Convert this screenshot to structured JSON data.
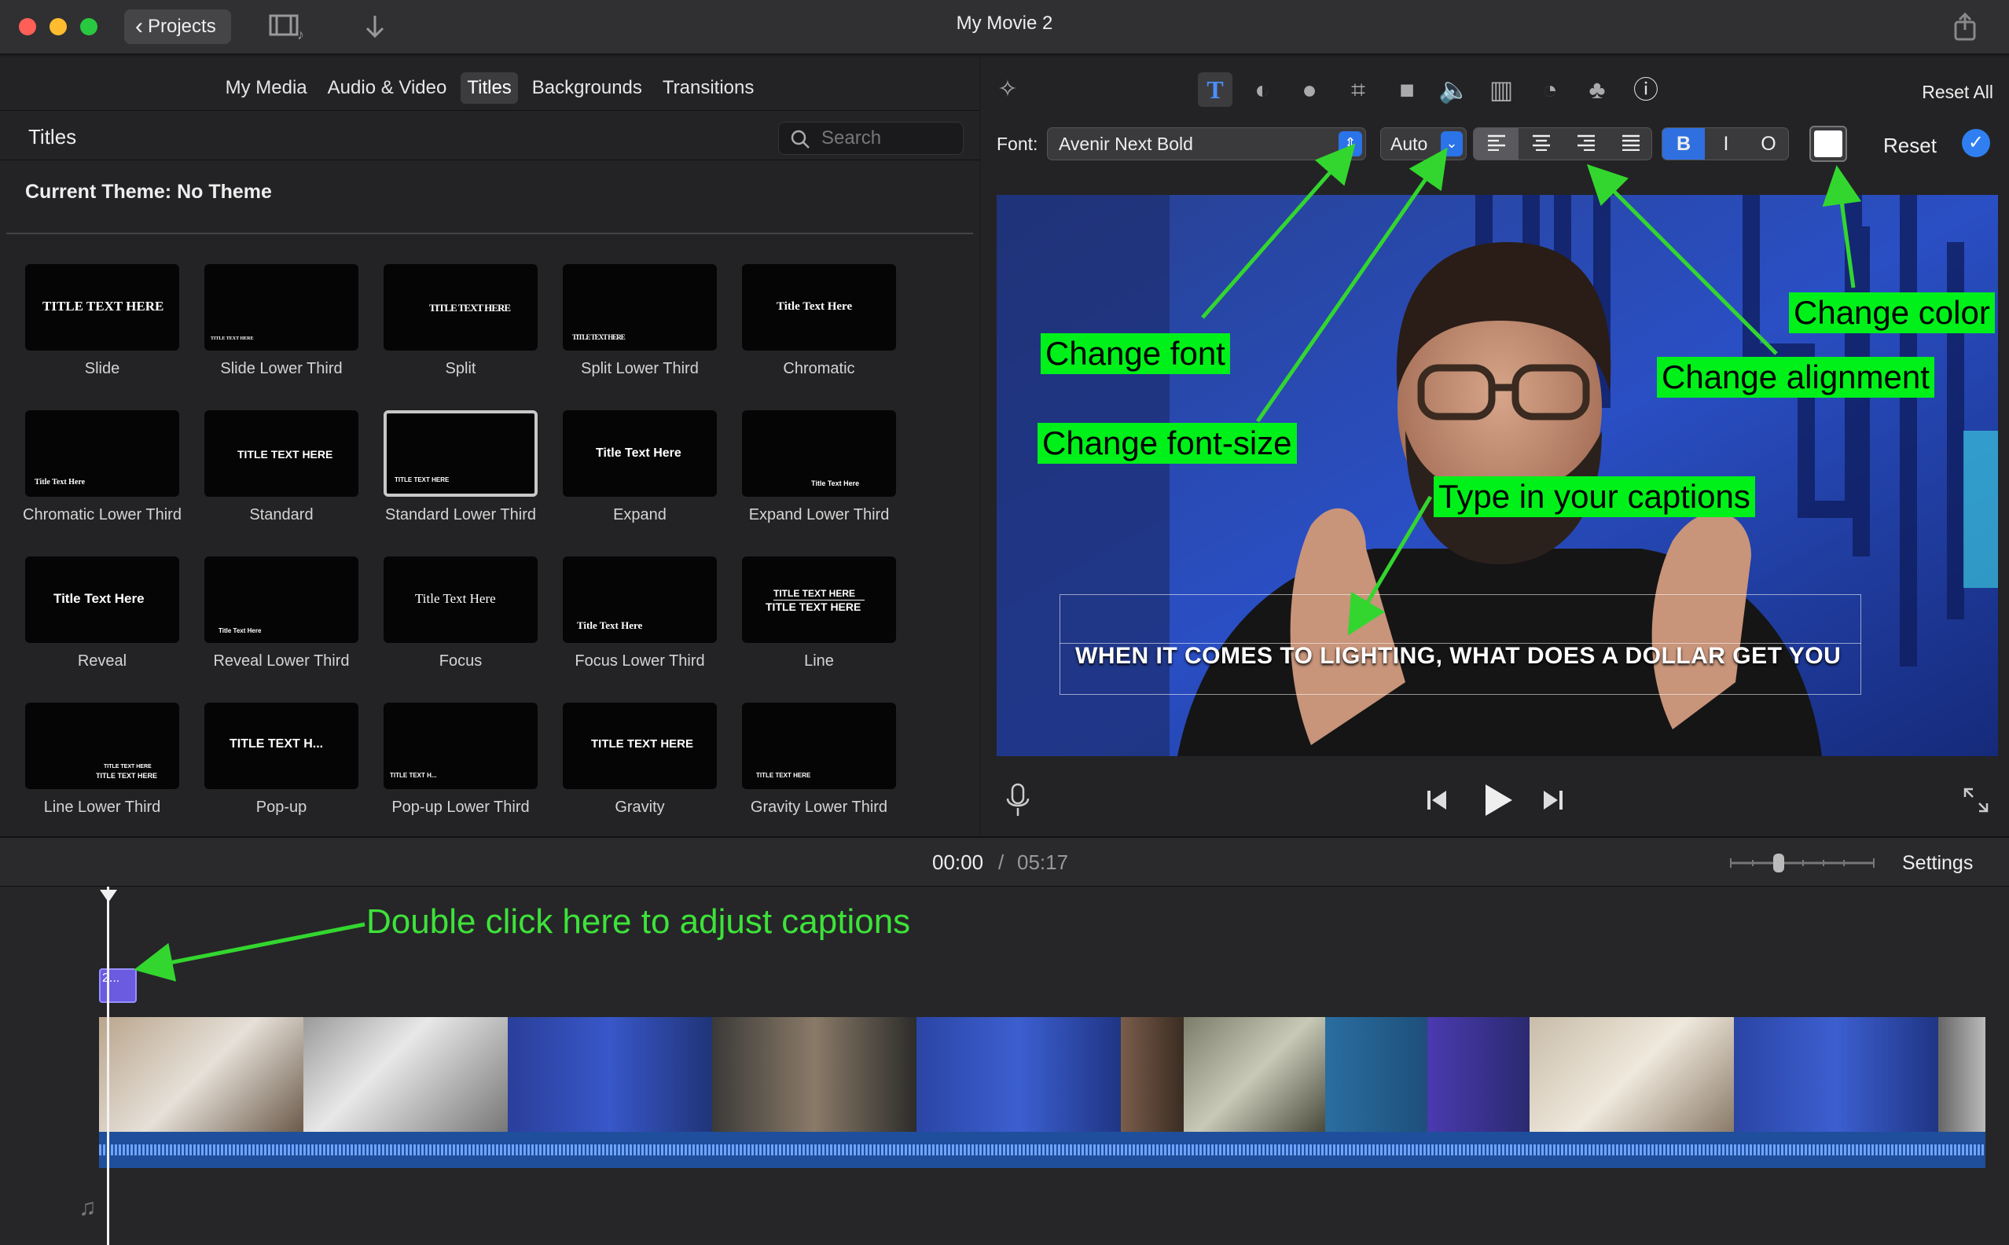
{
  "window": {
    "title": "My Movie 2",
    "back_label": "Projects"
  },
  "media_tabs": [
    "My Media",
    "Audio & Video",
    "Titles",
    "Backgrounds",
    "Transitions"
  ],
  "titles_panel": {
    "header": "Titles",
    "search_placeholder": "Search",
    "theme_label": "Current Theme: No Theme"
  },
  "tiles": [
    {
      "label": "Slide",
      "preview": "TITLE TEXT HERE"
    },
    {
      "label": "Slide Lower Third",
      "preview": "TITLE TEXT HERE"
    },
    {
      "label": "Split",
      "preview": "TITLE TEXT HERE"
    },
    {
      "label": "Split Lower Third",
      "preview": "TITLE TEXT HERE"
    },
    {
      "label": "Chromatic",
      "preview": "Title Text Here"
    },
    {
      "label": "Chromatic Lower Third",
      "preview": "Title Text Here"
    },
    {
      "label": "Standard",
      "preview": "TITLE TEXT HERE"
    },
    {
      "label": "Standard Lower Third",
      "preview": "TITLE TEXT HERE"
    },
    {
      "label": "Expand",
      "preview": "Title Text Here"
    },
    {
      "label": "Expand Lower Third",
      "preview": "Title Text Here"
    },
    {
      "label": "Reveal",
      "preview": "Title Text Here"
    },
    {
      "label": "Reveal Lower Third",
      "preview": "Title Text Here"
    },
    {
      "label": "Focus",
      "preview": "Title Text Here"
    },
    {
      "label": "Focus Lower Third",
      "preview": "Title Text Here"
    },
    {
      "label": "Line",
      "preview": "TITLE TEXT HERE"
    },
    {
      "label": "Line Lower Third",
      "preview": "TITLE TEXT HERE"
    },
    {
      "label": "Pop-up",
      "preview": "TITLE TEXT H..."
    },
    {
      "label": "Pop-up Lower Third",
      "preview": "TITLE TEXT H..."
    },
    {
      "label": "Gravity",
      "preview": "TITLE TEXT HERE"
    },
    {
      "label": "Gravity Lower Third",
      "preview": "TITLE TEXT HERE"
    }
  ],
  "inspector": {
    "reset_all": "Reset All",
    "font_label": "Font:",
    "font_value": "Avenir Next Bold",
    "size_value": "Auto",
    "bold": "B",
    "italic": "I",
    "outline": "O",
    "text_color": "#ffffff",
    "reset": "Reset"
  },
  "viewer": {
    "caption": "WHEN IT COMES TO LIGHTING, WHAT DOES A DOLLAR GET  YOU"
  },
  "annotations": {
    "change_font": "Change font",
    "change_font_size": "Change font-size",
    "change_color": "Change color",
    "change_alignment": "Change alignment",
    "type_captions": "Type in your captions",
    "double_click": "Double click here to adjust captions"
  },
  "playback": {
    "current_time": "00:00",
    "separator": "/",
    "total_time": "05:17",
    "settings": "Settings"
  },
  "timeline": {
    "title_clip_label": "2..."
  },
  "colors": {
    "accent": "#2f7ff0",
    "annotation_green": "#00f01a",
    "arrow_green": "#33d62f"
  }
}
